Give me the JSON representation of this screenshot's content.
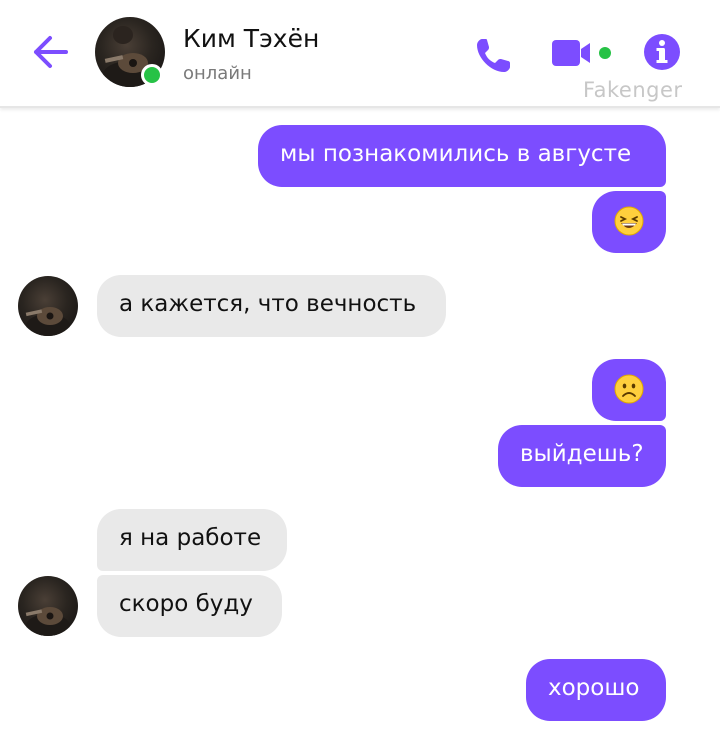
{
  "header": {
    "contact_name": "Ким Тэхён",
    "status": "онлайн",
    "watermark": "Fakenger"
  },
  "colors": {
    "accent": "#7c4dff",
    "incoming_bubble": "#e9e9e9",
    "online": "#27c246"
  },
  "icons": {
    "back": "arrow-left-icon",
    "call": "phone-icon",
    "video": "video-camera-icon",
    "info": "info-icon",
    "emoji_1": "grinning-squinting-face-emoji",
    "emoji_2": "frowning-face-emoji"
  },
  "messages": [
    {
      "side": "out",
      "text": "мы познакомились в августе"
    },
    {
      "side": "out",
      "text": "emoji:grinning-squinting"
    },
    {
      "side": "in",
      "text": "а кажется, что вечность"
    },
    {
      "side": "out",
      "text": "emoji:frowning"
    },
    {
      "side": "out",
      "text": "выйдешь?"
    },
    {
      "side": "in",
      "text": "я на работе"
    },
    {
      "side": "in",
      "text": "скоро буду"
    },
    {
      "side": "out",
      "text": "хорошо"
    }
  ]
}
